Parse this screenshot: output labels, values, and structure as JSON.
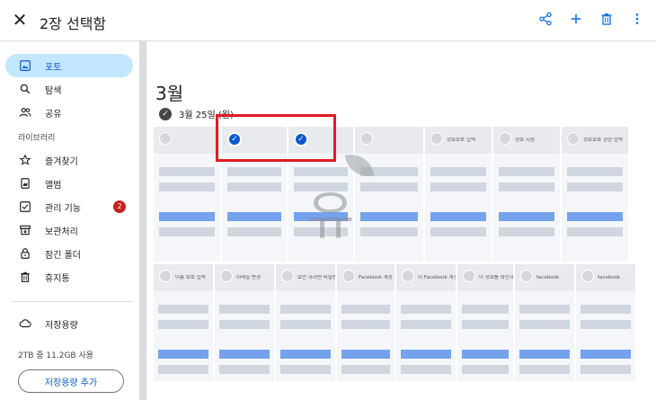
{
  "header": {
    "title": "2장 선택함",
    "close_icon": "close-icon",
    "actions": [
      {
        "name": "share-icon"
      },
      {
        "name": "add-icon"
      },
      {
        "name": "trash-icon"
      },
      {
        "name": "more-vert-icon"
      }
    ]
  },
  "sidebar": {
    "items": [
      {
        "label": "포토",
        "icon": "photo-icon",
        "active": true
      },
      {
        "label": "탐색",
        "icon": "search-icon"
      },
      {
        "label": "공유",
        "icon": "people-icon"
      }
    ],
    "library_label": "라이브러리",
    "library_items": [
      {
        "label": "즐겨찾기",
        "icon": "star-icon"
      },
      {
        "label": "앨범",
        "icon": "album-icon"
      },
      {
        "label": "관리 기능",
        "icon": "checklist-icon",
        "badge": "2"
      },
      {
        "label": "보관처리",
        "icon": "archive-icon"
      },
      {
        "label": "잠긴 폴더",
        "icon": "lock-icon"
      },
      {
        "label": "휴지통",
        "icon": "trash-icon"
      }
    ],
    "storage": {
      "label": "저장용량",
      "icon": "cloud-icon",
      "usage": "2TB 중 11.2GB 사용",
      "button": "저장용량 추가"
    }
  },
  "main": {
    "month": "3월",
    "date_label": "3월 25일 (월)",
    "row1": [
      {
        "selected": false,
        "caption": ""
      },
      {
        "selected": true,
        "caption": ""
      },
      {
        "selected": true,
        "caption": ""
      },
      {
        "selected": false,
        "caption": ""
      },
      {
        "selected": false,
        "caption": "정보보호 입력"
      },
      {
        "selected": false,
        "caption": "정보 지원"
      },
      {
        "selected": false,
        "caption": "정보보호 관련 입력"
      }
    ],
    "row2": [
      {
        "selected": false,
        "caption": "이름 보호 입력"
      },
      {
        "selected": false,
        "caption": "이메일 변경"
      },
      {
        "selected": false,
        "caption": "보안 하려면 비밀번호를 입력"
      },
      {
        "selected": false,
        "caption": "Facebook 계정 보호를 위해 확인"
      },
      {
        "selected": false,
        "caption": "이 Facebook 계정이 본인 계정입니까?"
      },
      {
        "selected": false,
        "caption": "이 정보를 확인하세요"
      },
      {
        "selected": false,
        "caption": "facebook"
      },
      {
        "selected": false,
        "caption": "facebook"
      }
    ]
  },
  "colors": {
    "accent": "#0b57d0",
    "active_nav_bg": "#c2e7ff",
    "badge": "#c5221f",
    "highlight": "#e01b24"
  }
}
